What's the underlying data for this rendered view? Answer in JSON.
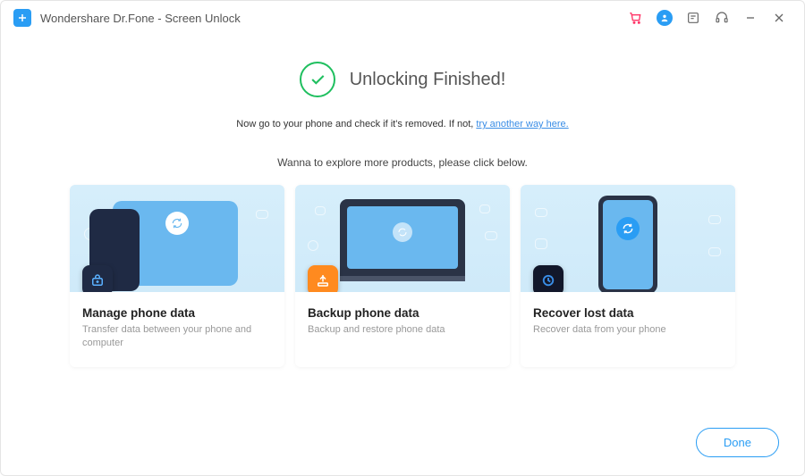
{
  "app": {
    "title": "Wondershare Dr.Fone - Screen Unlock"
  },
  "status": {
    "title": "Unlocking Finished!",
    "sub_prefix": "Now go to your phone and check if it's removed. If not, ",
    "sub_link": "try another way here."
  },
  "explore": "Wanna to explore more products,  please click below.",
  "cards": [
    {
      "title": "Manage phone data",
      "desc": "Transfer data between your phone and computer"
    },
    {
      "title": "Backup phone data",
      "desc": "Backup and restore phone data"
    },
    {
      "title": "Recover lost data",
      "desc": "Recover data from your phone"
    }
  ],
  "footer": {
    "done": "Done"
  }
}
